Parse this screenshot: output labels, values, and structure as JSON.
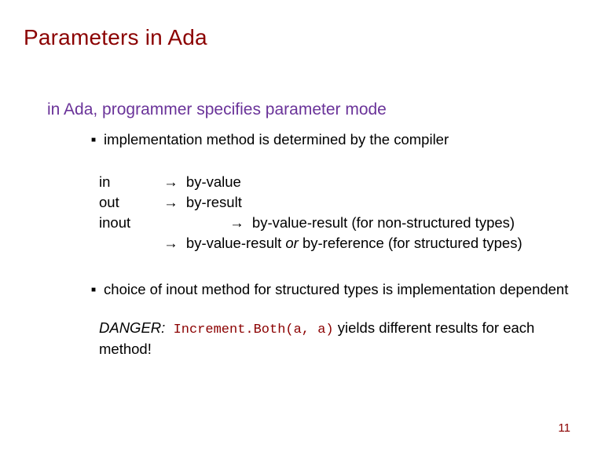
{
  "title": "Parameters in Ada",
  "subtitle": "in Ada, programmer specifies parameter mode",
  "bullet1": "implementation method is determined by the compiler",
  "modes": {
    "r1": "in",
    "r2": "out",
    "r3": "inout"
  },
  "arrows": {
    "a": "→"
  },
  "maps": {
    "m1": "by-value",
    "m2": "by-result",
    "m3a": "by-value-result (for non-structured types)",
    "m4a": "by-value-result ",
    "m4_or": "or",
    "m4b": " by-reference (for structured types)"
  },
  "bullet2": "choice of inout method for structured types is implementation dependent",
  "danger": {
    "label": "DANGER:",
    "code": "Increment.Both(a, a)",
    "tail": " yields different results for each method!"
  },
  "pagenum": "11"
}
